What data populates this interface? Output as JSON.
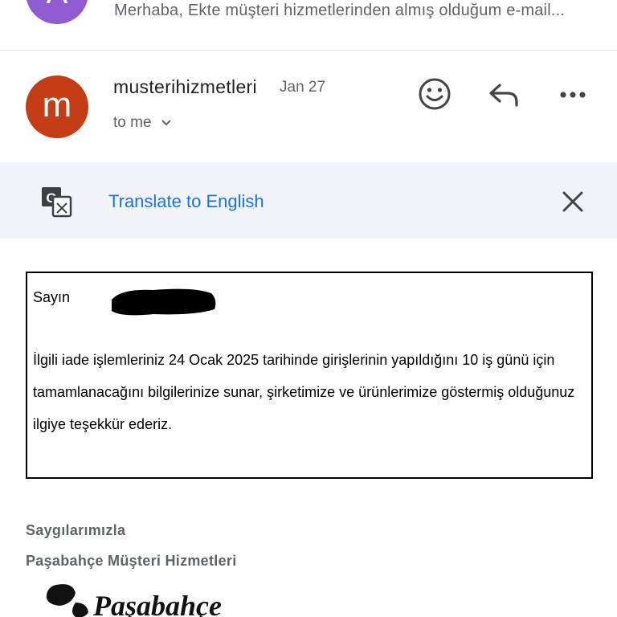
{
  "previous_email": {
    "avatar_letter": "A",
    "avatar_color": "#8e5bd0",
    "snippet": "Merhaba, Ekte müşteri hizmetlerinden almış olduğum e-mail..."
  },
  "email_header": {
    "avatar_letter": "m",
    "avatar_color": "#c43d14",
    "sender": "musterihizmetleri",
    "date": "Jan 27",
    "recipient": "to me",
    "icons": [
      "emoji-icon",
      "reply-icon",
      "more-icon"
    ]
  },
  "translate_bar": {
    "link_text": "Translate to English",
    "link_color": "#1a73e8",
    "icons": [
      "translate-icon",
      "close-icon"
    ]
  },
  "message": {
    "greeting": "Sayın",
    "body": "İlgili iade işlemleriniz 24 Ocak 2025 tarihinde girişlerinin yapıldığını 10 iş günü için tamamlanacağını bilgilerinize sunar, şirketimize ve ürünlerimize göstermiş olduğunuz ilgiye teşekkür ederiz."
  },
  "signature": {
    "closing": "Saygılarımızla",
    "company": "Paşabahçe Müşteri Hizmetleri",
    "logo_text": "Paşabahçe"
  }
}
